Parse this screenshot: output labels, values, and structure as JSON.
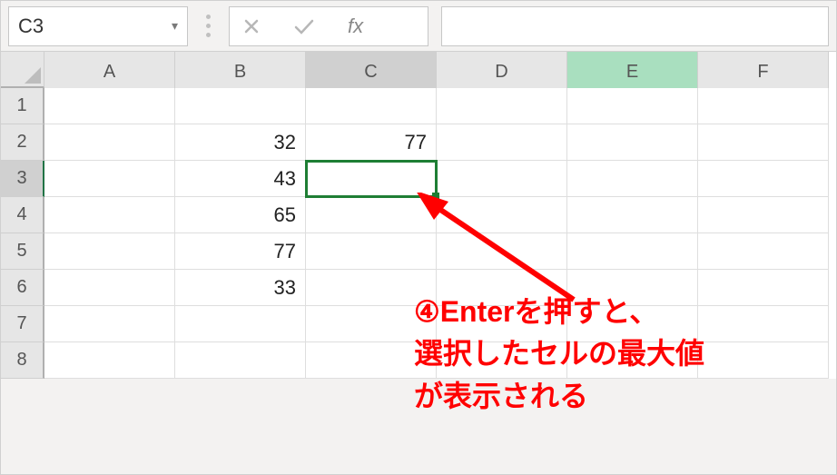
{
  "name_box": {
    "value": "C3"
  },
  "formula_bar": {
    "fx_label": "fx",
    "value": ""
  },
  "columns": [
    "A",
    "B",
    "C",
    "D",
    "E",
    "F"
  ],
  "rows": [
    1,
    2,
    3,
    4,
    5,
    6,
    7,
    8
  ],
  "active_cell": {
    "col": "C",
    "row": 3
  },
  "highlight_col": "E",
  "cells": {
    "B2": 32,
    "B3": 43,
    "B4": 65,
    "B5": 77,
    "B6": 33,
    "C2": 77
  },
  "annotation": {
    "line1": "④Enterを押すと、",
    "line2": "選択したセルの最大値",
    "line3": "が表示される"
  }
}
